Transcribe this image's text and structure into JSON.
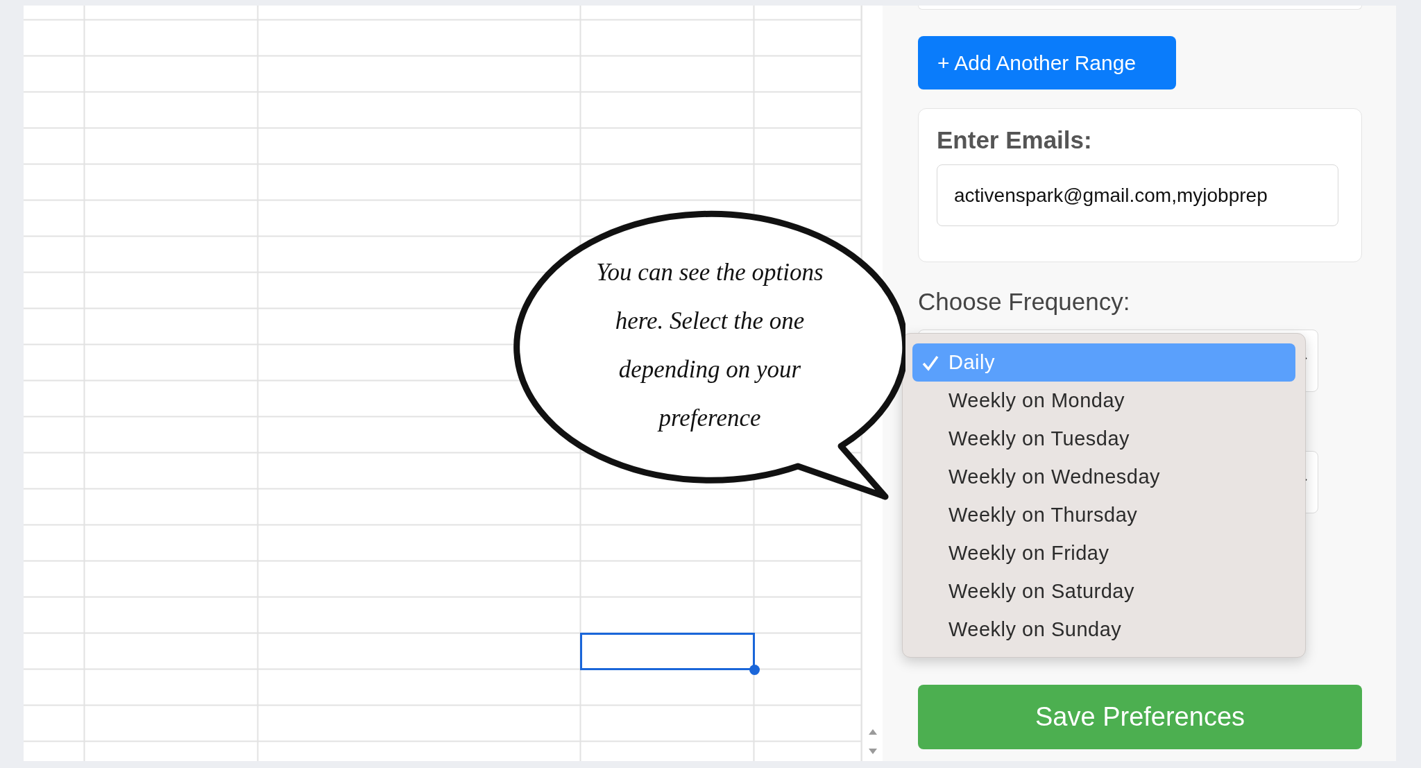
{
  "add_range_button": "+ Add Another Range",
  "emails": {
    "label": "Enter Emails:",
    "value": "activenspark@gmail.com,myjobprep"
  },
  "frequency": {
    "label": "Choose Frequency:",
    "options": [
      {
        "label": "Daily",
        "selected": true
      },
      {
        "label": "Weekly on Monday",
        "selected": false
      },
      {
        "label": "Weekly on Tuesday",
        "selected": false
      },
      {
        "label": "Weekly on Wednesday",
        "selected": false
      },
      {
        "label": "Weekly on Thursday",
        "selected": false
      },
      {
        "label": "Weekly on Friday",
        "selected": false
      },
      {
        "label": "Weekly on Saturday",
        "selected": false
      },
      {
        "label": "Weekly on Sunday",
        "selected": false
      }
    ]
  },
  "save_button": "Save Preferences",
  "callout": {
    "text": "You can see the options here. Select the one depending on your preference"
  }
}
